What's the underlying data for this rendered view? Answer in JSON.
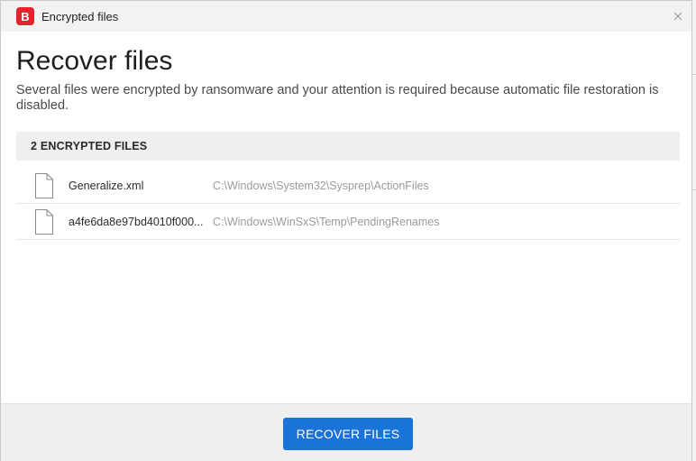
{
  "window": {
    "logo_letter": "B",
    "title": "Encrypted files"
  },
  "main": {
    "heading": "Recover files",
    "description": "Several files were encrypted by ransomware and your attention is required because automatic file restoration is disabled.",
    "files_header": "2 ENCRYPTED FILES",
    "files": [
      {
        "name": "Generalize.xml",
        "path": "C:\\Windows\\System32\\Sysprep\\ActionFiles",
        "icon": "file-icon"
      },
      {
        "name": "a4fe6da8e97bd4010f000...",
        "path": "C:\\Windows\\WinSxS\\Temp\\PendingRenames",
        "icon": "file-icon"
      }
    ]
  },
  "footer": {
    "recover_label": "RECOVER FILES"
  },
  "colors": {
    "brand": "#e3232e",
    "accent": "#1a73d9"
  }
}
